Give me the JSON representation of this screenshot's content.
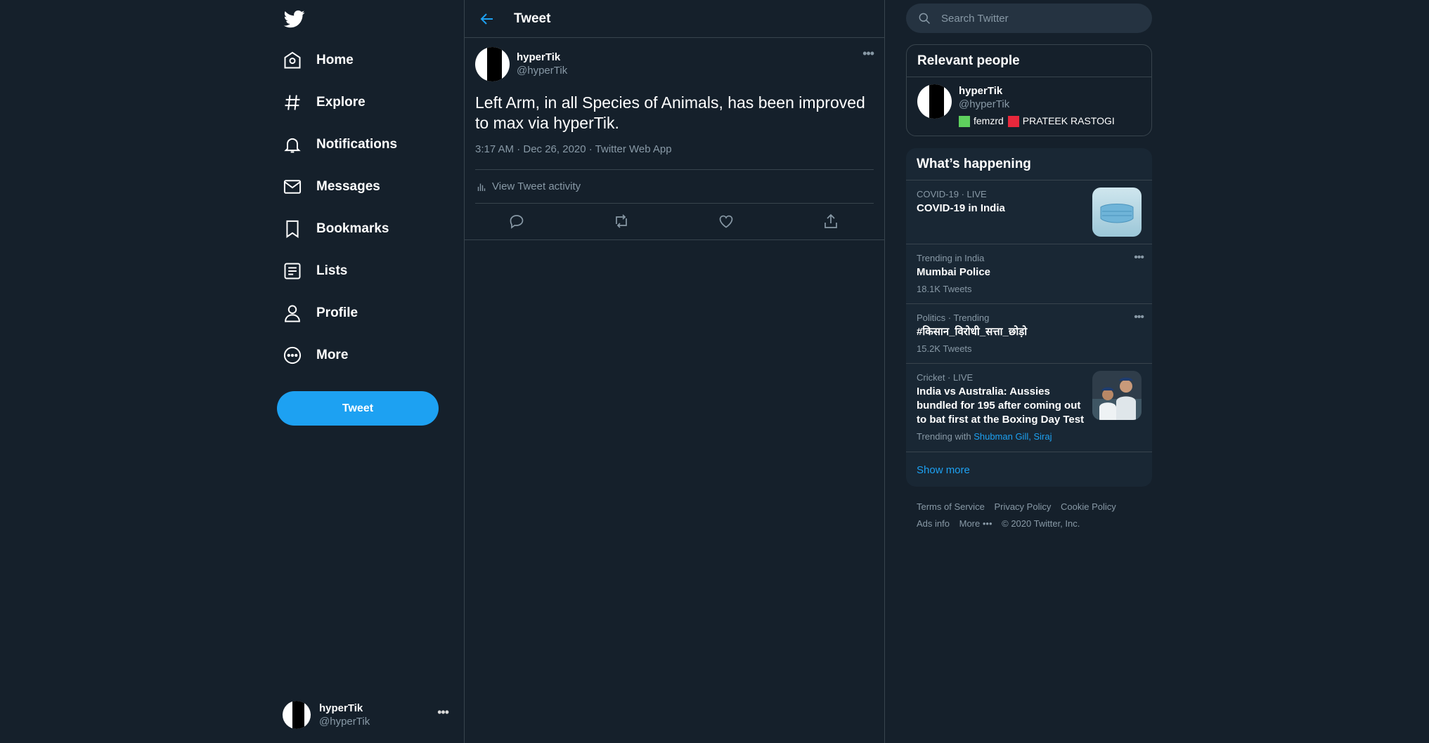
{
  "nav": {
    "items": [
      {
        "label": "Home",
        "icon": "home-icon"
      },
      {
        "label": "Explore",
        "icon": "hashtag-icon"
      },
      {
        "label": "Notifications",
        "icon": "bell-icon"
      },
      {
        "label": "Messages",
        "icon": "envelope-icon"
      },
      {
        "label": "Bookmarks",
        "icon": "bookmark-icon"
      },
      {
        "label": "Lists",
        "icon": "list-icon"
      },
      {
        "label": "Profile",
        "icon": "person-icon"
      },
      {
        "label": "More",
        "icon": "more-circle-icon"
      }
    ],
    "tweet_button": "Tweet",
    "account": {
      "name": "hyperTik",
      "handle": "@hyperTik",
      "more": "•••"
    }
  },
  "main": {
    "header_title": "Tweet",
    "tweet": {
      "author_name": "hyperTik",
      "author_handle": "@hyperTik",
      "more": "•••",
      "text": "Left Arm, in all Species of Animals, has been improved to max via hyperTik.",
      "meta": "3:17 AM · Dec 26, 2020 · Twitter Web App",
      "activity": "View Tweet activity"
    }
  },
  "right": {
    "search_placeholder": "Search Twitter",
    "relevant": {
      "title": "Relevant people",
      "person": {
        "name": "hyperTik",
        "handle": "@hyperTik",
        "bio_1": "femzrd",
        "bio_2": "PRATEEK RASTOGI"
      }
    },
    "trends": {
      "title": "What’s happening",
      "items": [
        {
          "meta": "COVID-19 · LIVE",
          "title": "COVID-19 in India"
        },
        {
          "meta": "Trending in India",
          "title": "Mumbai Police",
          "count": "18.1K Tweets",
          "more": "•••"
        },
        {
          "meta": "Politics · Trending",
          "title": "#किसान_विरोधी_सत्ता_छोड़ो",
          "count": "15.2K Tweets",
          "more": "•••"
        },
        {
          "meta": "Cricket · LIVE",
          "title": "India vs Australia: Aussies bundled for 195 after coming out to bat first at the Boxing Day Test",
          "with_label": "Trending with",
          "with_links": "Shubman Gill, Siraj"
        }
      ],
      "show_more": "Show more"
    },
    "footer": {
      "terms": "Terms of Service",
      "privacy": "Privacy Policy",
      "cookie": "Cookie Policy",
      "ads": "Ads info",
      "more": "More •••",
      "copyright": "© 2020 Twitter, Inc."
    }
  },
  "colors": {
    "background": "#15202b",
    "accent": "#1da1f2",
    "border": "#38444d",
    "muted": "#8899a6"
  }
}
